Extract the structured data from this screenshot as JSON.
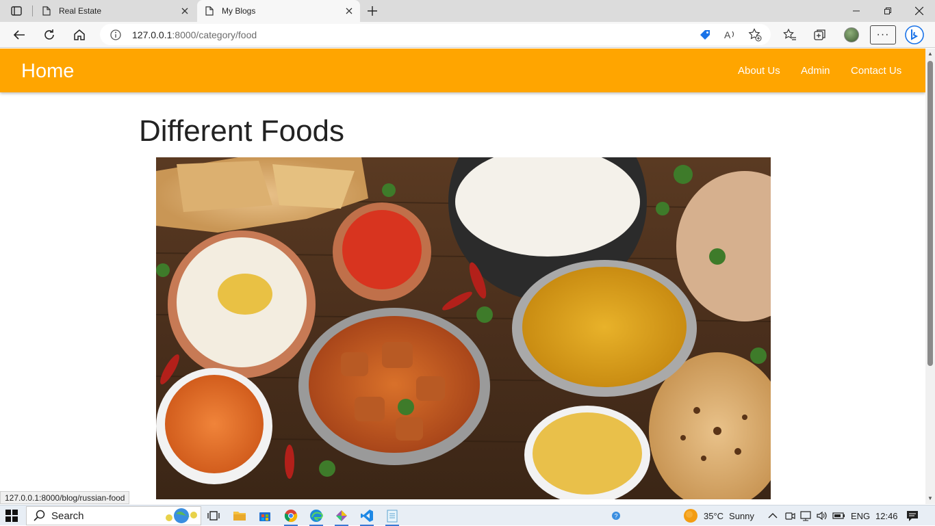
{
  "browser": {
    "tabs": [
      {
        "title": "Real Estate",
        "active": false
      },
      {
        "title": "My Blogs",
        "active": true
      }
    ],
    "url_host": "127.0.0.1",
    "url_rest": ":8000/category/food",
    "more_label": "···",
    "status_url": "127.0.0.1:8000/blog/russian-food"
  },
  "site": {
    "brand": "Home",
    "nav": [
      "About Us",
      "Admin",
      "Contact Us"
    ],
    "nav_color": "#ffa500"
  },
  "page": {
    "title": "Different Foods"
  },
  "taskbar": {
    "search_label": "Search",
    "weather_temp": "35°C",
    "weather_text": "Sunny",
    "language": "ENG",
    "time": "12:46"
  }
}
